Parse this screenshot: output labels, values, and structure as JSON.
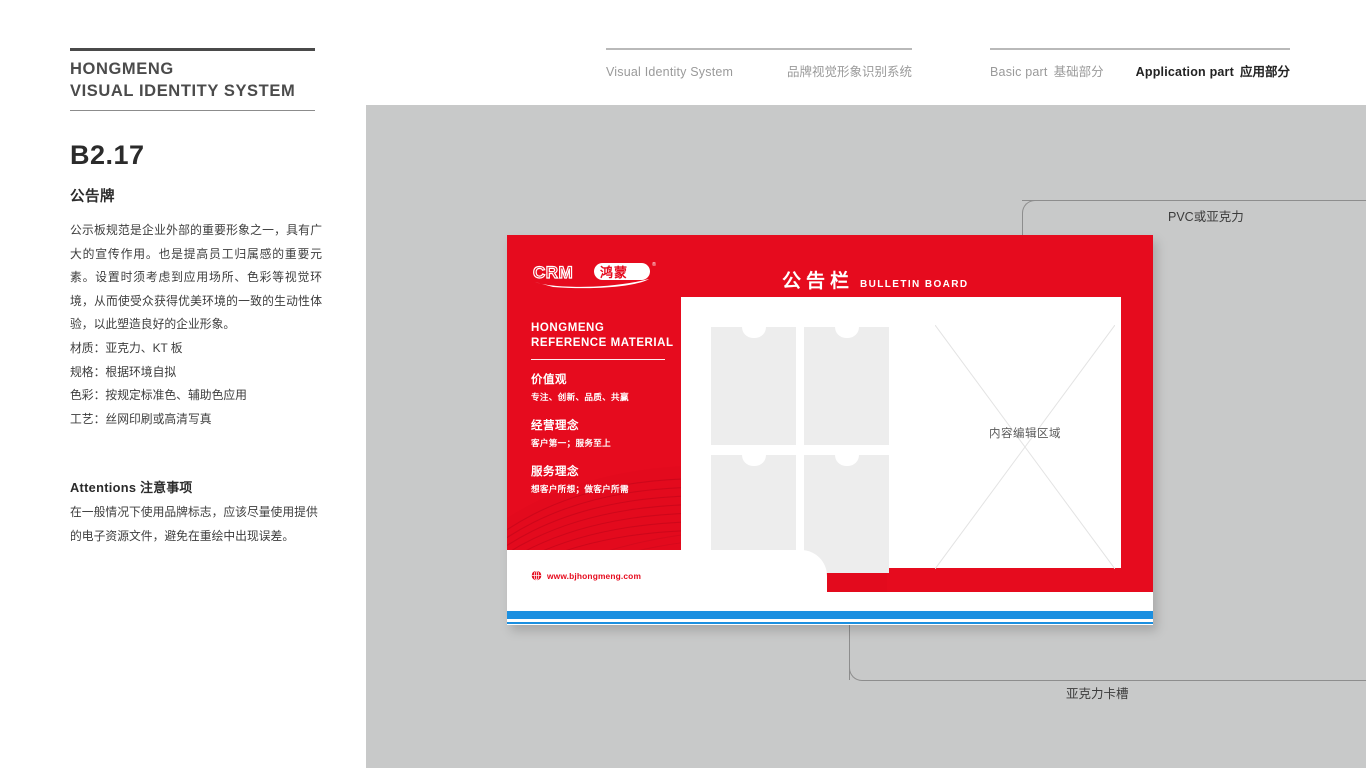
{
  "header": {
    "brand_line1": "HONGMENG",
    "brand_line2": "VISUAL IDENTITY SYSTEM",
    "group1_en": "Visual Identity System",
    "group1_cn": "品牌视觉形象识别系统",
    "group2_en": "Basic part",
    "group2_cn": "基础部分",
    "group3_en": "Application part",
    "group3_cn": "应用部分"
  },
  "left_column": {
    "section_code": "B2.17",
    "section_title": "公告牌",
    "description": "公示板规范是企业外部的重要形象之一，具有广大的宣传作用。也是提高员工归属感的重要元素。设置时须考虑到应用场所、色彩等视觉环境，从而使受众获得优美环境的一致的生动性体验，以此塑造良好的企业形象。",
    "specs": [
      "材质：亚克力、KT 板",
      "规格：根据环境自拟",
      "色彩：按规定标准色、辅助色应用",
      "工艺：丝网印刷或高清写真"
    ],
    "attentions_title": "Attentions 注意事项",
    "attentions_body": "在一般情况下使用品牌标志，应该尽量使用提供的电子资源文件，避免在重绘中出现误差。"
  },
  "callouts": {
    "top_label": "PVC或亚克力",
    "bottom_label": "亚克力卡槽"
  },
  "board": {
    "logo_text": "CRM",
    "logo_cn": "鸿蒙",
    "logo_mark": "®",
    "reference_line1": "HONGMENG",
    "reference_line2": "REFERENCE MATERIAL",
    "title_cn": "公告栏",
    "title_en": "BULLETIN BOARD",
    "values": [
      {
        "heading": "价值观",
        "sub": "专注、创新、品质、共赢"
      },
      {
        "heading": "经营理念",
        "sub": "客户第一；服务至上"
      },
      {
        "heading": "服务理念",
        "sub": "想客户所想；做客户所需"
      }
    ],
    "website": "www.bjhongmeng.com",
    "content_area_label": "内容编辑区域"
  },
  "colors": {
    "brand_red": "#e60b1e",
    "accent_blue": "#1b8fe0",
    "stage_gray": "#c8c9c9",
    "slot_gray": "#ededed"
  }
}
